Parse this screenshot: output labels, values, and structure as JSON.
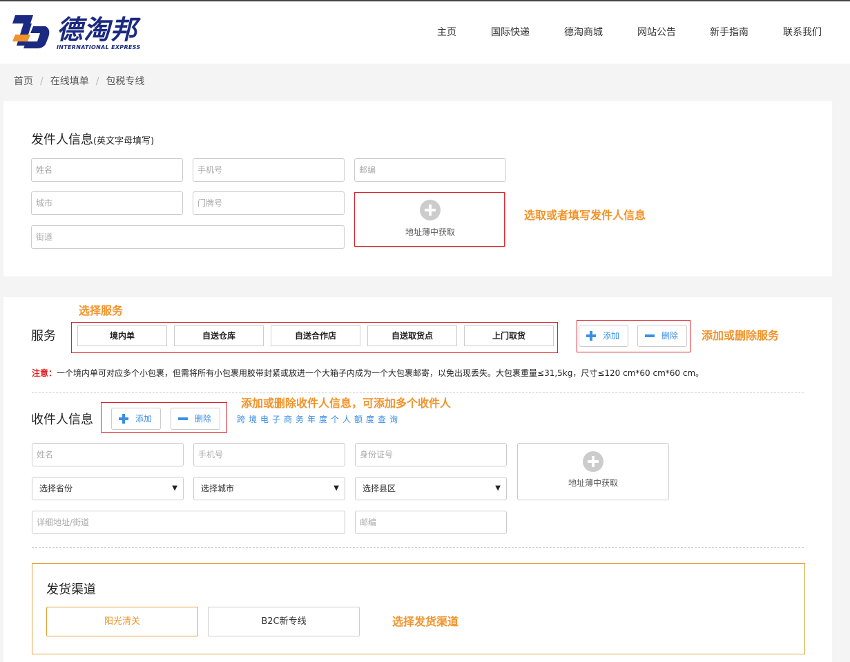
{
  "logo": {
    "name": "德淘邦",
    "subtitle": "INTERNATIONAL EXPRESS"
  },
  "nav": [
    "主页",
    "国际快递",
    "德淘商城",
    "网站公告",
    "新手指南",
    "联系我们"
  ],
  "breadcrumb": [
    "首页",
    "在线填单",
    "包税专线"
  ],
  "sender": {
    "title": "发件人信息",
    "title_note": "(英文字母填写)",
    "name_ph": "姓名",
    "phone_ph": "手机号",
    "zip_ph": "邮编",
    "city_ph": "城市",
    "house_ph": "门牌号",
    "street_ph": "街道",
    "addr_book": "地址薄中获取"
  },
  "services": {
    "title": "服务",
    "items": [
      "境内单",
      "自送仓库",
      "自送合作店",
      "自送取货点",
      "上门取货"
    ],
    "add": "添加",
    "delete": "删除"
  },
  "notice": {
    "label": "注意：",
    "text": "一个境内单可对应多个小包裹，但需将所有小包裹用胶带封紧或放进一个大箱子内成为一个大包裹邮寄，以免出现丢失。大包裹重量≤31,5kg，尺寸≤120 cm*60 cm*60 cm。"
  },
  "receiver": {
    "title": "收件人信息",
    "add": "添加",
    "delete": "删除",
    "quota_link": "跨境电子商务年度个人额度查询",
    "name_ph": "姓名",
    "phone_ph": "手机号",
    "id_ph": "身份证号",
    "province": "选择省份",
    "city": "选择城市",
    "district": "选择县区",
    "street_ph": "详细地址/街道",
    "zip_ph": "邮编",
    "addr_book": "地址薄中获取"
  },
  "channel": {
    "title": "发货渠道",
    "options": [
      "阳光清关",
      "B2C新专线"
    ],
    "selected": "阳光清关"
  },
  "annotations": {
    "sender": "选取或者填写发件人信息",
    "service": "选择服务",
    "add_service": "添加或删除服务",
    "receiver": "添加或删除收件人信息，可添加多个收件人",
    "channel": "选择发货渠道"
  },
  "colors": {
    "brand_blue": "#1b2a80",
    "brand_orange": "#f0932b",
    "annotation": "#f0932b",
    "highlight_box": "#d9232b",
    "link_blue": "#3a8ee6"
  }
}
